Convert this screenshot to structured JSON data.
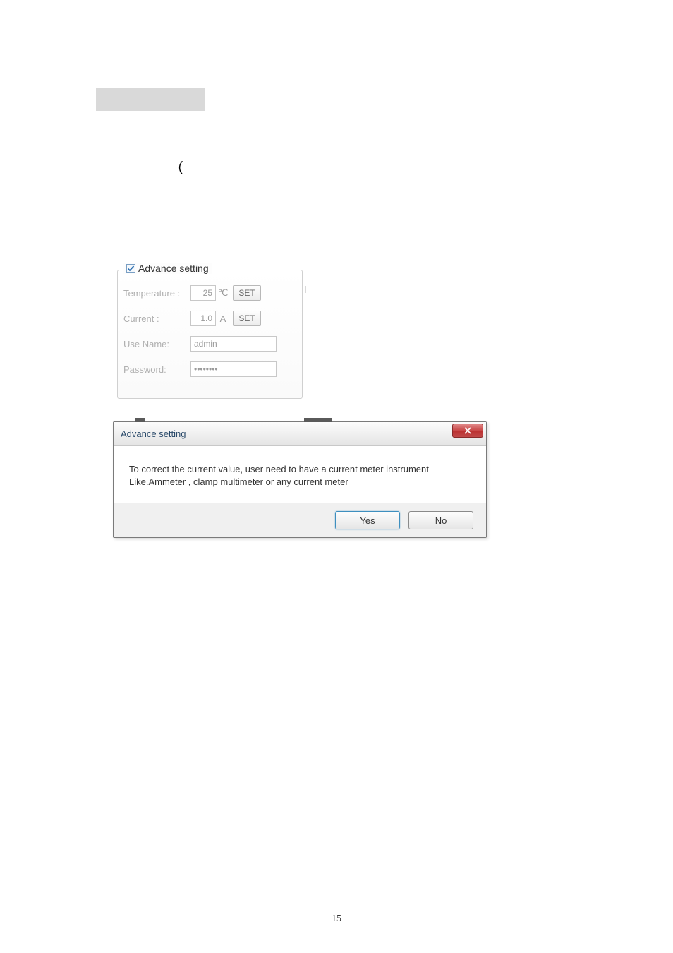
{
  "misc": {
    "paren": "（"
  },
  "panel": {
    "legend": "Advance setting",
    "rows": {
      "temperature": {
        "label": "Temperature :",
        "value": "25",
        "unit": "℃",
        "button": "SET"
      },
      "current": {
        "label": "Current :",
        "value": "1.0",
        "unit": "A",
        "button": "SET"
      },
      "username": {
        "label": "Use Name:",
        "value": "admin"
      },
      "password": {
        "label": "Password:",
        "value": "********"
      }
    }
  },
  "dialog": {
    "title": "Advance setting",
    "body_line1": "To correct the current value, user need to have a current meter instrument",
    "body_line2": "Like.Ammeter , clamp multimeter or any current meter",
    "yes": "Yes",
    "no": "No"
  },
  "page_number": "15"
}
